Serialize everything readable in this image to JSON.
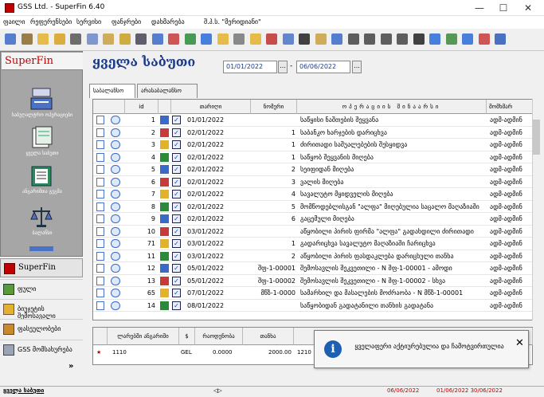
{
  "window": {
    "title": "GSS Ltd. - SuperFin 6.40"
  },
  "menu": [
    "ფაილი",
    "რეფერენსები",
    "სერვისი",
    "ფანჯრები",
    "დახმარება",
    "შ.პ.ს. \"მერიდიანი\""
  ],
  "header": {
    "title": "ყველა საბუთი",
    "date_from": "01/01/2022",
    "date_to": "06/06/2022",
    "date_sep": "-",
    "date_btn": "..."
  },
  "tabs": [
    "საბალანსო",
    "არასაბალანსო"
  ],
  "sidebar": {
    "brand": "SuperFin",
    "tiles": [
      "საბუღალტრო ოპერაციები",
      "ყველა საბუთი",
      "ანგარიშთა გეგმა",
      "ბალანსი"
    ],
    "scroll_glyph": "▼",
    "nav": [
      {
        "label": "SuperFin",
        "icon": "superfin-icon"
      },
      {
        "label": "ფული",
        "icon": "money-icon"
      },
      {
        "label": "ბიუჯეტის შემოსავალი",
        "icon": "budget-icon"
      },
      {
        "label": "ფასეულობები",
        "icon": "valuables-icon"
      },
      {
        "label": "GSS მომსახურება",
        "icon": "gss-icon"
      }
    ],
    "more": "»"
  },
  "grid": {
    "columns": [
      "id",
      "თარიღი",
      "ნომერი",
      "ოპერაციის შინაარსი",
      "მომხმარ"
    ],
    "rows": [
      {
        "id": "1",
        "date": "01/01/2022",
        "num": "",
        "desc": "საწყისი ნაშთების შეყვანა",
        "user": "ადმ-ადმინ"
      },
      {
        "id": "2",
        "date": "02/01/2022",
        "num": "1",
        "desc": "საბანკო ხარჯების დარიცხვა",
        "user": "ადმ-ადმინ"
      },
      {
        "id": "3",
        "date": "02/01/2022",
        "num": "1",
        "desc": "ძირითადი საშუალებების შესყიდვა",
        "user": "ადმ-ადმინ"
      },
      {
        "id": "4",
        "date": "02/01/2022",
        "num": "1",
        "desc": "საწყობ შეყვანის მიღება",
        "user": "ადმ-ადმინ"
      },
      {
        "id": "5",
        "date": "02/01/2022",
        "num": "2",
        "desc": "სეიფიდან მიღება",
        "user": "ადმ-ადმინ"
      },
      {
        "id": "6",
        "date": "02/01/2022",
        "num": "3",
        "desc": "ვალის მიღება",
        "user": "ადმ-ადმინ"
      },
      {
        "id": "7",
        "date": "02/01/2022",
        "num": "4",
        "desc": "სავალუტო მყიდველის მიღება",
        "user": "ადმ-ადმინ"
      },
      {
        "id": "8",
        "date": "02/01/2022",
        "num": "5",
        "desc": "მომწოდებლისგან \"ალფა\" მიღებულია საცალო მაღაზიაში",
        "user": "ადმ-ადმინ"
      },
      {
        "id": "9",
        "date": "02/01/2022",
        "num": "6",
        "desc": "გაცემული მიღება",
        "user": "ადმ-ადმინ"
      },
      {
        "id": "10",
        "date": "03/01/2022",
        "num": "",
        "desc": "აწყობილი პირის ფირმა \"ალფა\" გადახდილი ძირითადი",
        "user": "ადმ-ადმინ"
      },
      {
        "id": "71",
        "date": "03/01/2022",
        "num": "1",
        "desc": "გადარიცხვა სავალუტო მაღაზიაში ჩარიცხვა",
        "user": "ადმ-ადმინ"
      },
      {
        "id": "11",
        "date": "03/01/2022",
        "num": "2",
        "desc": "აწყობილი პირის ფასდაკლება დარიცხული თანხა",
        "user": "ადმ-ადმინ"
      },
      {
        "id": "12",
        "date": "05/01/2022",
        "num": "შფ-1-00001",
        "desc": "შემოსავლის შეკვეთილი - N შფ-1-00001 - ამოდი",
        "user": "ადმ-ადმინ"
      },
      {
        "id": "13",
        "date": "05/01/2022",
        "num": "შფ-1-00002",
        "desc": "შემოსავლის შეკვეთილი - N შფ-1-00002 - სხვა",
        "user": "ადმ-ადმინ"
      },
      {
        "id": "65",
        "date": "07/01/2022",
        "num": "მწზ-1-0000",
        "desc": "სამარხილ და მასალების მოძრაობა - N მწზ-1-00001",
        "user": "ადმ-ადმინ"
      },
      {
        "id": "14",
        "date": "08/01/2022",
        "num": "",
        "desc": "საწყობიდან გადატანილი თანხის გადატანა",
        "user": "ადმ-ადმინ"
      }
    ]
  },
  "bottom": {
    "columns": [
      "ლარებში ანგარიში",
      "$",
      "რაოდენობა",
      "თანხა"
    ],
    "row": {
      "acct": "1110",
      "cur": "GEL",
      "qty": "0.0000",
      "amt": "2000.00",
      "extra": "1210"
    }
  },
  "popup": {
    "message": "ყველაფერი აქტიურებულია და ჩამოტვირთულია",
    "close": "✕",
    "icon": "i"
  },
  "status": {
    "left": "ყველა საბუთი",
    "date1": "06/06/2022",
    "range": "01/06/2022 30/06/2022",
    "arrow": "◁▷"
  },
  "colors": {
    "brand": "#c00000",
    "heading": "#1a3a8a",
    "sidebar": "#a6a6a6"
  }
}
